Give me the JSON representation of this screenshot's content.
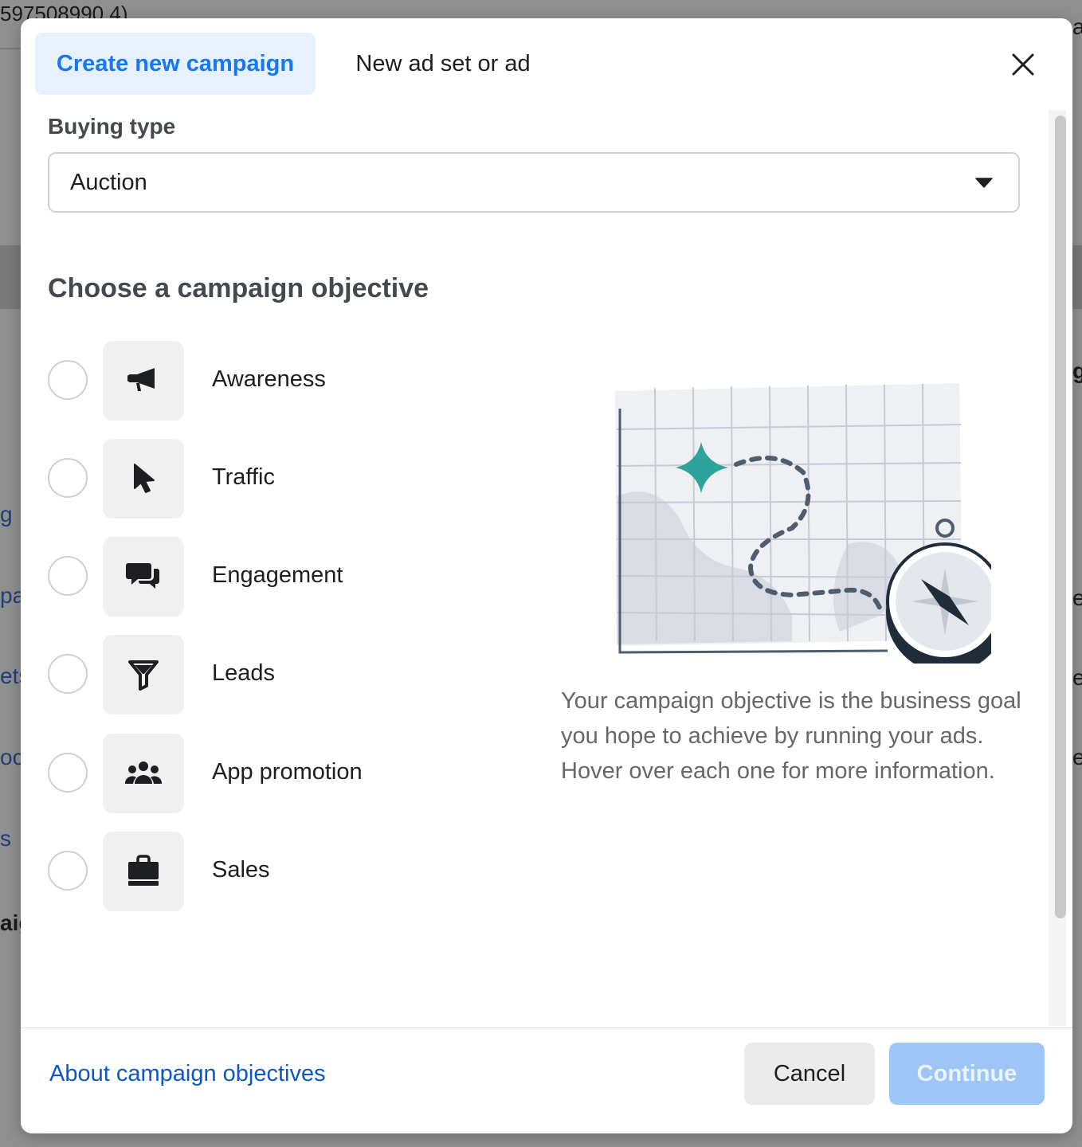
{
  "background": {
    "top_left_text": "597508990 4)",
    "left_fragments": [
      "g",
      "pa",
      "ets",
      "oc",
      "s",
      "aig"
    ],
    "right_fragments": [
      "ar",
      "gy",
      "e",
      "e",
      "e"
    ]
  },
  "modal": {
    "tabs": [
      {
        "label": "Create new campaign",
        "active": true
      },
      {
        "label": "New ad set or ad",
        "active": false
      }
    ],
    "buying_type": {
      "label": "Buying type",
      "value": "Auction"
    },
    "objective": {
      "heading": "Choose a campaign objective",
      "options": [
        {
          "label": "Awareness",
          "icon": "megaphone-icon"
        },
        {
          "label": "Traffic",
          "icon": "cursor-icon"
        },
        {
          "label": "Engagement",
          "icon": "chat-bubbles-icon"
        },
        {
          "label": "Leads",
          "icon": "filter-icon"
        },
        {
          "label": "App promotion",
          "icon": "people-group-icon"
        },
        {
          "label": "Sales",
          "icon": "shopping-bag-icon"
        }
      ],
      "description": "Your campaign objective is the business goal you hope to achieve by running your ads. Hover over each one for more information."
    },
    "footer": {
      "about_link": "About campaign objectives",
      "cancel_label": "Cancel",
      "continue_label": "Continue"
    }
  },
  "colors": {
    "accent": "#1877f2",
    "tab_active_bg": "#e7f0fd",
    "continue_disabled_bg": "#9dc5f6",
    "link": "#0a58ca"
  }
}
